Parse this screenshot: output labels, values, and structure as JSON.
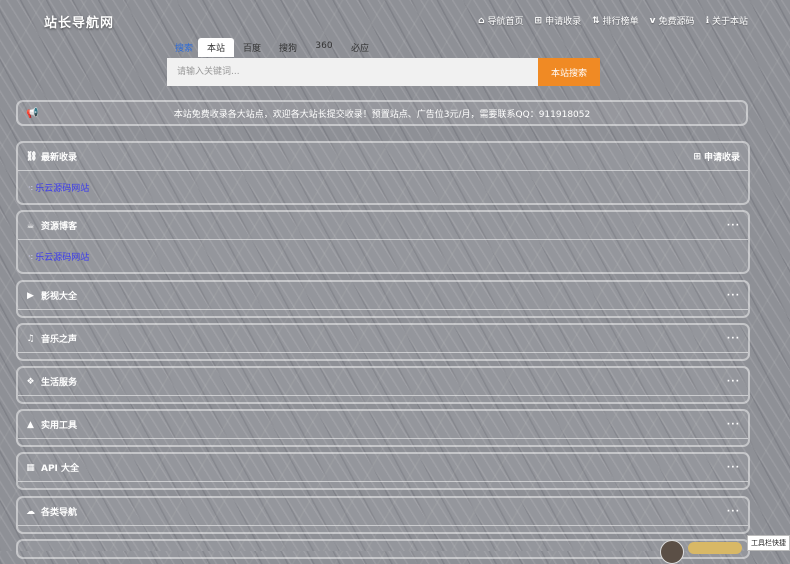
{
  "site": {
    "logo": "站长导航网"
  },
  "topnav": [
    {
      "icon": "home-icon",
      "glyph": "⌂",
      "label": "导航首页"
    },
    {
      "icon": "plus-square-icon",
      "glyph": "⊞",
      "label": "申请收录"
    },
    {
      "icon": "sort-icon",
      "glyph": "⇅",
      "label": "排行榜单"
    },
    {
      "icon": "vimeo-icon",
      "glyph": "v",
      "label": "免费源码"
    },
    {
      "icon": "info-icon",
      "glyph": "ℹ",
      "label": "关于本站"
    }
  ],
  "search": {
    "tab_label": "搜索",
    "tabs": [
      "本站",
      "百度",
      "搜狗",
      "360",
      "必应"
    ],
    "active_tab": "本站",
    "placeholder": "请输入关键词...",
    "value": "",
    "button": "本站搜索"
  },
  "notice": {
    "icon": "bullhorn-icon",
    "text": "本站免费收录各大站点，欢迎各大站长提交收录！预置站点、广告位3元/月，需要联系QQ：911918052"
  },
  "panels": [
    {
      "title": "最新收录",
      "icon": "link-icon",
      "glyph": "⛓",
      "action": "申请收录",
      "link": "乐云源码网站"
    },
    {
      "title": "资源博客",
      "icon": "cup-icon",
      "glyph": "☕",
      "action": "···",
      "link": "乐云源码网站"
    },
    {
      "title": "影视大全",
      "icon": "video-icon",
      "glyph": "▶",
      "action": "···"
    },
    {
      "title": "音乐之声",
      "icon": "music-icon",
      "glyph": "♫",
      "action": "···"
    },
    {
      "title": "生活服务",
      "icon": "cubes-icon",
      "glyph": "❖",
      "action": "···"
    },
    {
      "title": "实用工具",
      "icon": "graduation-cap-icon",
      "glyph": "▲",
      "action": "···"
    },
    {
      "title": "API 大全",
      "icon": "grid-icon",
      "glyph": "▦",
      "action": "···"
    },
    {
      "title": "各类导航",
      "icon": "cloud-icon",
      "glyph": "☁",
      "action": "···"
    }
  ],
  "corner": {
    "label": "工具栏快捷"
  }
}
